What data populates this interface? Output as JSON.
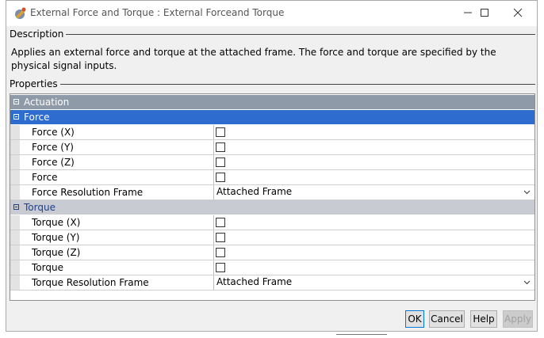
{
  "window": {
    "title": "External Force and Torque : External Forceand Torque"
  },
  "description": {
    "label": "Description",
    "text": "Applies an external force and torque at the attached frame. The force and torque are specified by the physical signal inputs."
  },
  "properties": {
    "label": "Properties",
    "actuation": "Actuation",
    "force_group": {
      "label": "Force",
      "rows": [
        {
          "name": "Force (X)",
          "checked": false
        },
        {
          "name": "Force (Y)",
          "checked": false
        },
        {
          "name": "Force (Z)",
          "checked": false
        },
        {
          "name": "Force",
          "checked": false
        }
      ],
      "frame_label": "Force Resolution Frame",
      "frame_value": "Attached Frame"
    },
    "torque_group": {
      "label": "Torque",
      "rows": [
        {
          "name": "Torque (X)",
          "checked": false
        },
        {
          "name": "Torque (Y)",
          "checked": false
        },
        {
          "name": "Torque (Z)",
          "checked": false
        },
        {
          "name": "Torque",
          "checked": false
        }
      ],
      "frame_label": "Torque Resolution Frame",
      "frame_value": "Attached Frame"
    }
  },
  "buttons": {
    "ok": "OK",
    "cancel": "Cancel",
    "help": "Help",
    "apply": "Apply"
  },
  "colors": {
    "actuation_header": "#8f9aa8",
    "force_header_selected": "#2e6ccf",
    "torque_header": "#c8ccd2"
  }
}
